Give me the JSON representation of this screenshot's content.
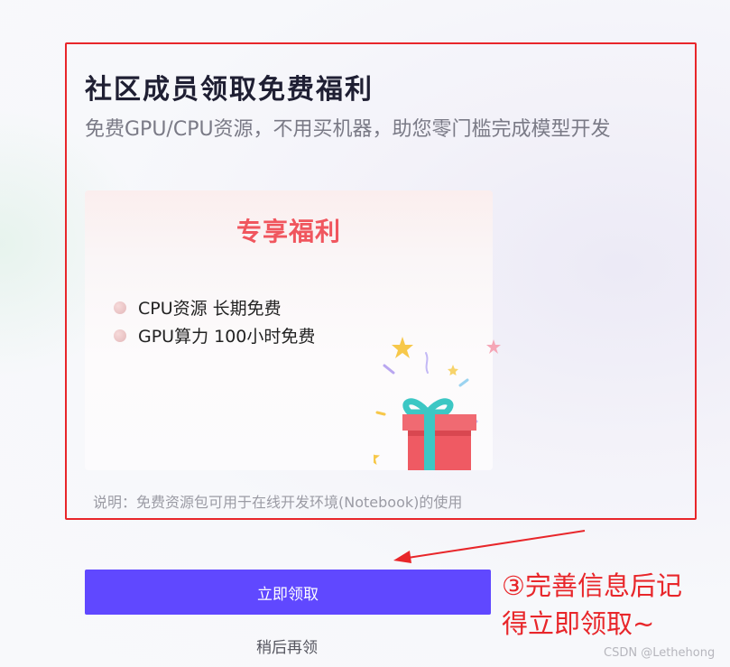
{
  "dialog": {
    "title": "社区成员领取免费福利",
    "subtitle": "免费GPU/CPU资源，不用买机器，助您零门槛完成模型开发",
    "card": {
      "heading": "专享福利",
      "benefits": [
        {
          "label": "CPU资源 长期免费"
        },
        {
          "label": "GPU算力 100小时免费"
        }
      ]
    },
    "note": "说明：免费资源包可用于在线开发环境(Notebook)的使用",
    "claim_button_label": "立即领取",
    "later_link_label": "稍后再领"
  },
  "annotation": {
    "callout_line1": "③完善信息后记",
    "callout_line2": "得立即领取~",
    "color": "#e8262a"
  },
  "watermark": "CSDN @Lethehong",
  "colors": {
    "accent": "#6048ff",
    "heading_red": "#f0565e",
    "annotation_red": "#e8262a"
  }
}
